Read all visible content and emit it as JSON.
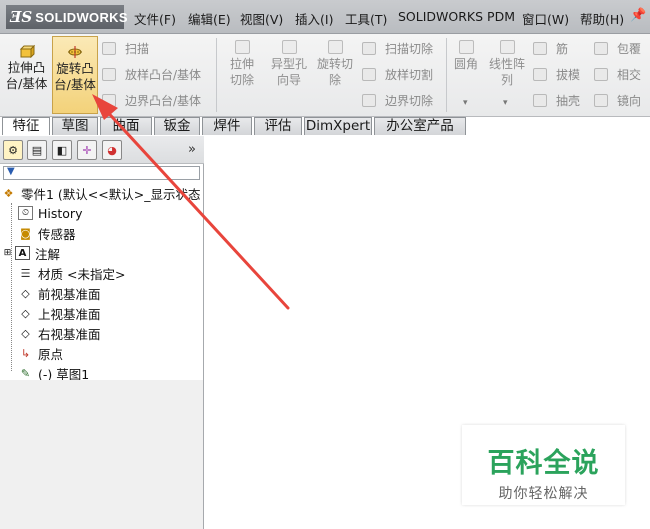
{
  "menubar": {
    "logo_ds": "ƎS",
    "logo_text": "SOLIDWORKS",
    "items": [
      "文件(F)",
      "编辑(E)",
      "视图(V)",
      "插入(I)",
      "工具(T)",
      "SOLIDWORKS PDM",
      "窗口(W)",
      "帮助(H)"
    ]
  },
  "commands": {
    "extrude_boss": "拉伸凸台/基体",
    "revolve_boss": "旋转凸台/基体",
    "sweep": "扫描",
    "loft_boss": "放样凸台/基体",
    "boundary_boss": "边界凸台/基体",
    "extrude_cut": "拉伸切除",
    "hole_wizard": "异型孔向导",
    "revolve_cut": "旋转切除",
    "swept_cut": "扫描切除",
    "lofted_cut": "放样切割",
    "boundary_cut": "边界切除",
    "fillet": "圆角",
    "linear_pattern": "线性阵列",
    "rib": "筋",
    "draft": "拔模",
    "shell": "抽壳",
    "wrap": "包覆",
    "intersect": "相交",
    "mirror": "镜向"
  },
  "tabs": [
    "特征",
    "草图",
    "曲面",
    "钣金",
    "焊件",
    "评估",
    "DimXpert",
    "办公室产品"
  ],
  "active_tab": "特征",
  "feature_tree": {
    "root": "零件1 (默认<<默认>_显示状态",
    "items": [
      "History",
      "传感器",
      "注解",
      "材质 <未指定>",
      "前视基准面",
      "上视基准面",
      "右视基准面",
      "原点",
      "(-) 草图1"
    ]
  },
  "fm_more": "»",
  "filter_icon": "filter-icon",
  "colors": {
    "highlight": "#f3d27a",
    "arrow": "#e8453c",
    "watermark": "#2ba35c"
  },
  "watermark": {
    "title": "百科全说",
    "subtitle": "助你轻松解决"
  }
}
